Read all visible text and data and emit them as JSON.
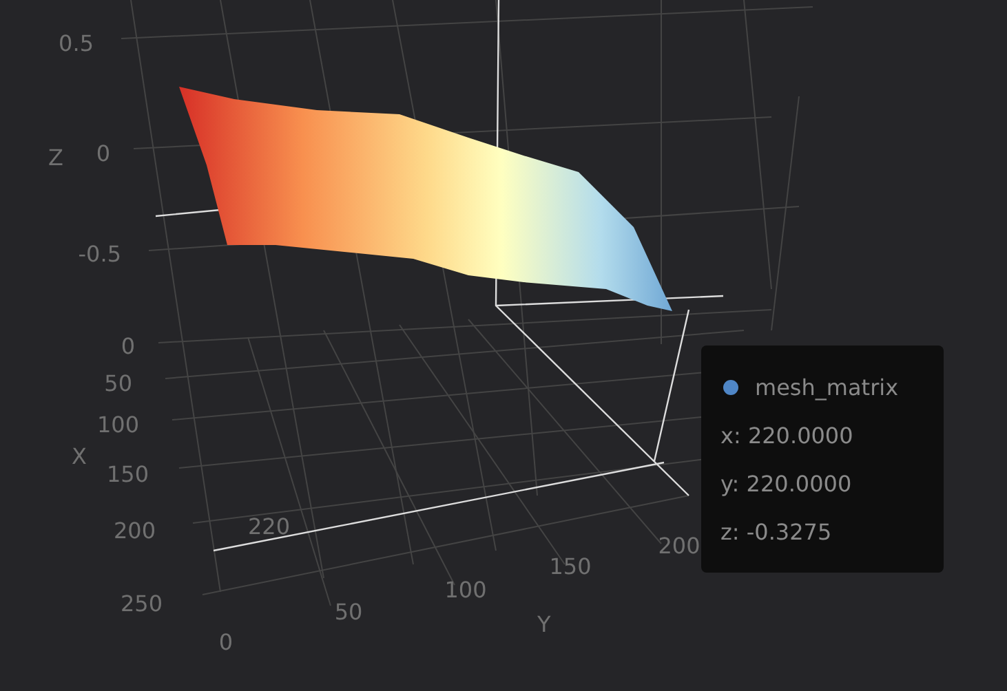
{
  "chart": {
    "z_axis": {
      "name": "Z",
      "ticks": [
        "0.5",
        "0",
        "-0.5"
      ]
    },
    "x_axis": {
      "name": "X",
      "ticks": [
        "0",
        "50",
        "100",
        "150",
        "200",
        "250"
      ],
      "pointer_label": "220"
    },
    "y_axis": {
      "name": "Y",
      "ticks": [
        "0",
        "50",
        "100",
        "150",
        "200"
      ]
    }
  },
  "tooltip": {
    "series": "mesh_matrix",
    "color": "#4f86c6",
    "lines": [
      "x: 220.0000",
      "y: 220.0000",
      "z: -0.3275"
    ]
  }
}
